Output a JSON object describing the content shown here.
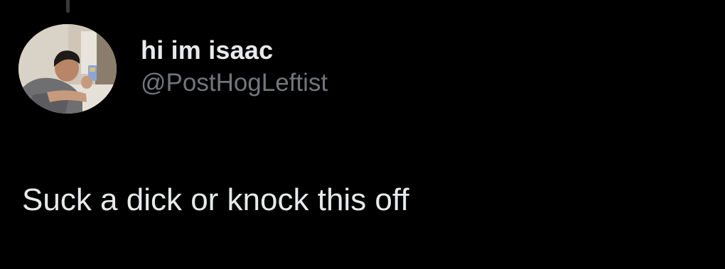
{
  "tweet": {
    "author": {
      "display_name": "hi im isaac",
      "handle": "@PostHogLeftist",
      "avatar": "profile-photo"
    },
    "text": "Suck a dick or knock this off"
  },
  "colors": {
    "background": "#000000",
    "primary_text": "#e7e9ea",
    "secondary_text": "#71767b",
    "thread_line": "#3a3a3a"
  }
}
